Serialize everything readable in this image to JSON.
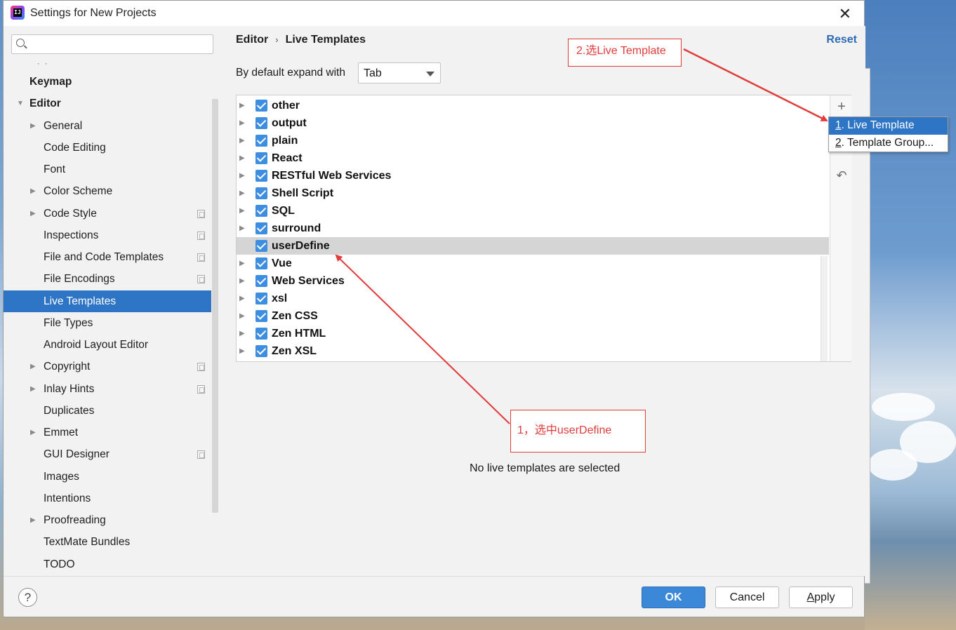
{
  "window": {
    "title": "Settings for New Projects"
  },
  "sidebar": {
    "search_placeholder": "",
    "items": [
      {
        "label": "Keymap",
        "level": 0,
        "bold": true,
        "arrow": ""
      },
      {
        "label": "Editor",
        "level": 0,
        "bold": true,
        "arrow": "▼"
      },
      {
        "label": "General",
        "level": 1,
        "arrow": "▶"
      },
      {
        "label": "Code Editing",
        "level": 1,
        "arrow": ""
      },
      {
        "label": "Font",
        "level": 1,
        "arrow": ""
      },
      {
        "label": "Color Scheme",
        "level": 1,
        "arrow": "▶"
      },
      {
        "label": "Code Style",
        "level": 1,
        "arrow": "▶",
        "project_icon": true
      },
      {
        "label": "Inspections",
        "level": 1,
        "arrow": "",
        "project_icon": true
      },
      {
        "label": "File and Code Templates",
        "level": 1,
        "arrow": "",
        "project_icon": true
      },
      {
        "label": "File Encodings",
        "level": 1,
        "arrow": "",
        "project_icon": true
      },
      {
        "label": "Live Templates",
        "level": 1,
        "arrow": "",
        "selected": true
      },
      {
        "label": "File Types",
        "level": 1,
        "arrow": ""
      },
      {
        "label": "Android Layout Editor",
        "level": 1,
        "arrow": ""
      },
      {
        "label": "Copyright",
        "level": 1,
        "arrow": "▶",
        "project_icon": true
      },
      {
        "label": "Inlay Hints",
        "level": 1,
        "arrow": "▶",
        "project_icon": true
      },
      {
        "label": "Duplicates",
        "level": 1,
        "arrow": ""
      },
      {
        "label": "Emmet",
        "level": 1,
        "arrow": "▶"
      },
      {
        "label": "GUI Designer",
        "level": 1,
        "arrow": "",
        "project_icon": true
      },
      {
        "label": "Images",
        "level": 1,
        "arrow": ""
      },
      {
        "label": "Intentions",
        "level": 1,
        "arrow": ""
      },
      {
        "label": "Proofreading",
        "level": 1,
        "arrow": "▶"
      },
      {
        "label": "TextMate Bundles",
        "level": 1,
        "arrow": ""
      },
      {
        "label": "TODO",
        "level": 1,
        "arrow": ""
      }
    ]
  },
  "main": {
    "breadcrumb": {
      "first": "Editor",
      "separator": "›",
      "second": "Live Templates"
    },
    "reset_label": "Reset",
    "expand_label": "By default expand with",
    "expand_value": "Tab",
    "template_groups": [
      {
        "name": "other",
        "checked": true
      },
      {
        "name": "output",
        "checked": true
      },
      {
        "name": "plain",
        "checked": true
      },
      {
        "name": "React",
        "checked": true
      },
      {
        "name": "RESTful Web Services",
        "checked": true
      },
      {
        "name": "Shell Script",
        "checked": true
      },
      {
        "name": "SQL",
        "checked": true
      },
      {
        "name": "surround",
        "checked": true
      },
      {
        "name": "userDefine",
        "checked": true,
        "selected": true,
        "no_arrow": true
      },
      {
        "name": "Vue",
        "checked": true
      },
      {
        "name": "Web Services",
        "checked": true
      },
      {
        "name": "xsl",
        "checked": true
      },
      {
        "name": "Zen CSS",
        "checked": true
      },
      {
        "name": "Zen HTML",
        "checked": true
      },
      {
        "name": "Zen XSL",
        "checked": true
      }
    ],
    "toolbar": {
      "add": "+",
      "undo": "↶"
    },
    "add_menu": [
      {
        "mnemonic": "1",
        "label": ". Live Template",
        "active": true
      },
      {
        "mnemonic": "2",
        "label": ". Template Group..."
      }
    ],
    "empty_text": "No live templates are selected"
  },
  "annotations": {
    "step2": "2.选Live Template",
    "step1": "1，选中userDefine",
    "color": "#e23b3b"
  },
  "footer": {
    "help": "?",
    "ok": "OK",
    "cancel": "Cancel",
    "apply_mnemonic": "A",
    "apply_rest": "pply"
  },
  "colors": {
    "accent": "#2e75c6",
    "checkbox": "#3d8de0",
    "ok_button": "#3b87d8",
    "link": "#2d6bb5"
  }
}
